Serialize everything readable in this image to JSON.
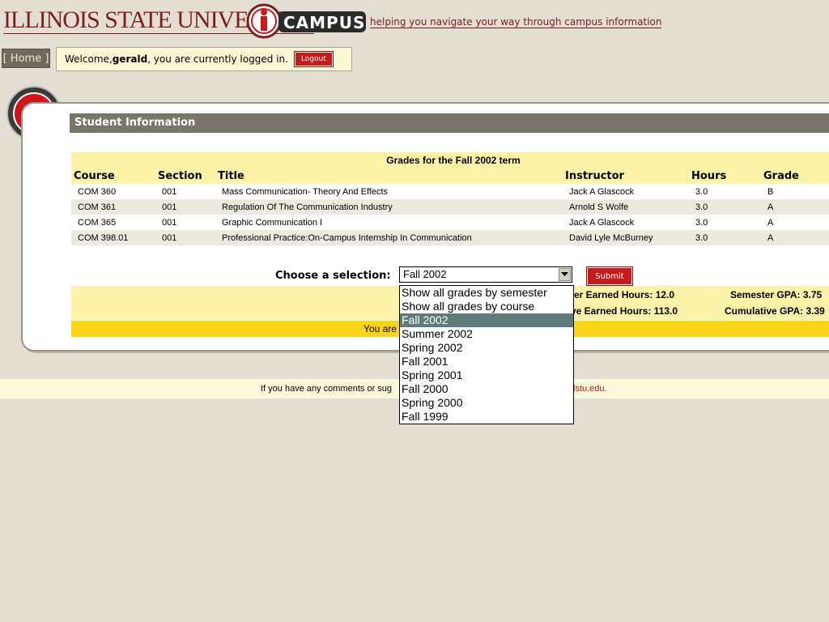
{
  "header": {
    "university_name": "ILLINOIS STATE UNIVERSITY",
    "tagline": "helping you navigate your way through campus information"
  },
  "nav": {
    "home_label": "[ Home ]",
    "welcome_prefix": "Welcome, ",
    "username": "gerald",
    "welcome_suffix": ", you are currently logged in.",
    "logout_label": "Logout"
  },
  "panel": {
    "title": "Student Information"
  },
  "grades": {
    "term_heading": "Grades for the Fall 2002 term",
    "columns": [
      "Course",
      "Section",
      "Title",
      "Instructor",
      "Hours",
      "Grade"
    ],
    "rows": [
      {
        "course": "COM 360",
        "section": "001",
        "title": "Mass Communication- Theory And Effects",
        "instructor": "Jack A Glascock",
        "hours": "3.0",
        "grade": "B"
      },
      {
        "course": "COM 361",
        "section": "001",
        "title": "Regulation Of The Communication Industry",
        "instructor": "Arnold S Wolfe",
        "hours": "3.0",
        "grade": "A"
      },
      {
        "course": "COM 365",
        "section": "001",
        "title": "Graphic Communication I",
        "instructor": "Jack A Glascock",
        "hours": "3.0",
        "grade": "A"
      },
      {
        "course": "COM 398.01",
        "section": "001",
        "title": "Professional Practice:On-Campus Internship In Communication",
        "instructor": "David Lyle McBurney",
        "hours": "3.0",
        "grade": "A"
      }
    ]
  },
  "selection": {
    "label": "Choose a selection:",
    "selected_value": "Fall 2002",
    "submit_label": "Submit",
    "options": [
      "Show all grades by semester",
      "Show all grades by course",
      "Fall 2002",
      "Summer 2002",
      "Spring 2002",
      "Fall 2001",
      "Spring 2001",
      "Fall 2000",
      "Spring 2000",
      "Fall 1999"
    ]
  },
  "summary": {
    "semester_hours": "ter Earned Hours: 12.0",
    "semester_gpa": "Semester GPA: 3.75",
    "cumulative_hours": "ve Earned Hours: 113.0",
    "cumulative_gpa": "Cumulative GPA: 3.39",
    "status_visible": "You are"
  },
  "footer": {
    "text_visible": "If you have any comments or sug",
    "email_tail": "lstu.edu."
  },
  "colors": {
    "brand_red": "#c8191b",
    "title_bar": "#79756a",
    "highlight_yellow": "#fcf3a8",
    "status_yellow": "#fbd41c",
    "selected_option": "#5f7b7a"
  }
}
